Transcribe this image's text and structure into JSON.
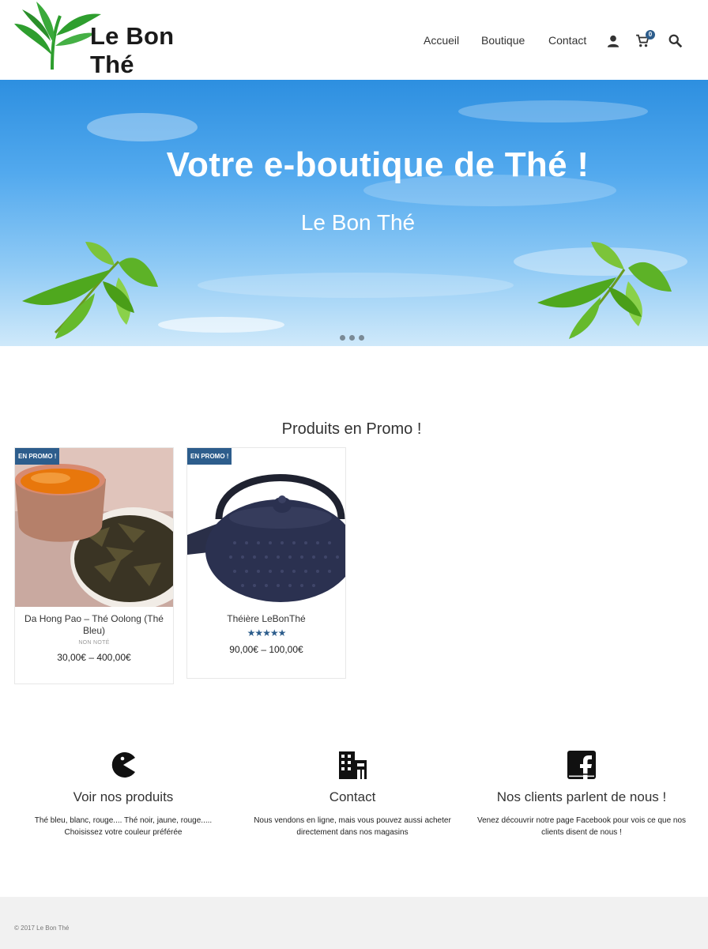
{
  "brand": {
    "name": "Le Bon Thé"
  },
  "nav": {
    "items": [
      {
        "label": "Accueil"
      },
      {
        "label": "Boutique"
      },
      {
        "label": "Contact"
      }
    ],
    "cart_count": "0",
    "icons": [
      "user-icon",
      "cart-icon",
      "search-icon"
    ]
  },
  "hero": {
    "title": "Votre e-boutique de Thé !",
    "subtitle": "Le Bon Thé",
    "slides": 3
  },
  "promo": {
    "title": "Produits en Promo !",
    "products": [
      {
        "badge": "EN PROMO !",
        "name": "Da Hong Pao – Thé Oolong (Thé Bleu)",
        "rating_text": "NON NOTÉ",
        "price": "30,00€ – 400,00€"
      },
      {
        "badge": "EN PROMO !",
        "name": "Théière LeBonThé",
        "stars": "★★★★★",
        "rating": 5,
        "price": "90,00€ – 100,00€"
      }
    ]
  },
  "features": [
    {
      "icon": "pacman-icon",
      "title": "Voir nos produits",
      "text": "Thé bleu, blanc, rouge.... Thé noir, jaune, rouge..... Choisissez votre couleur préférée"
    },
    {
      "icon": "building-icon",
      "title": "Contact",
      "text": "Nous vendons en ligne, mais vous pouvez aussi acheter directement dans nos magasins"
    },
    {
      "icon": "facebook-icon",
      "title": "Nos clients parlent de nous !",
      "text": "Venez découvrir notre page Facebook pour vois ce que nos clients disent de nous !"
    }
  ],
  "footer": {
    "copyright": "© 2017 Le Bon Thé"
  },
  "colors": {
    "accent": "#2d5d8c",
    "logo_green": "#2e9e2e",
    "footer_bg": "#f1f1f1"
  }
}
